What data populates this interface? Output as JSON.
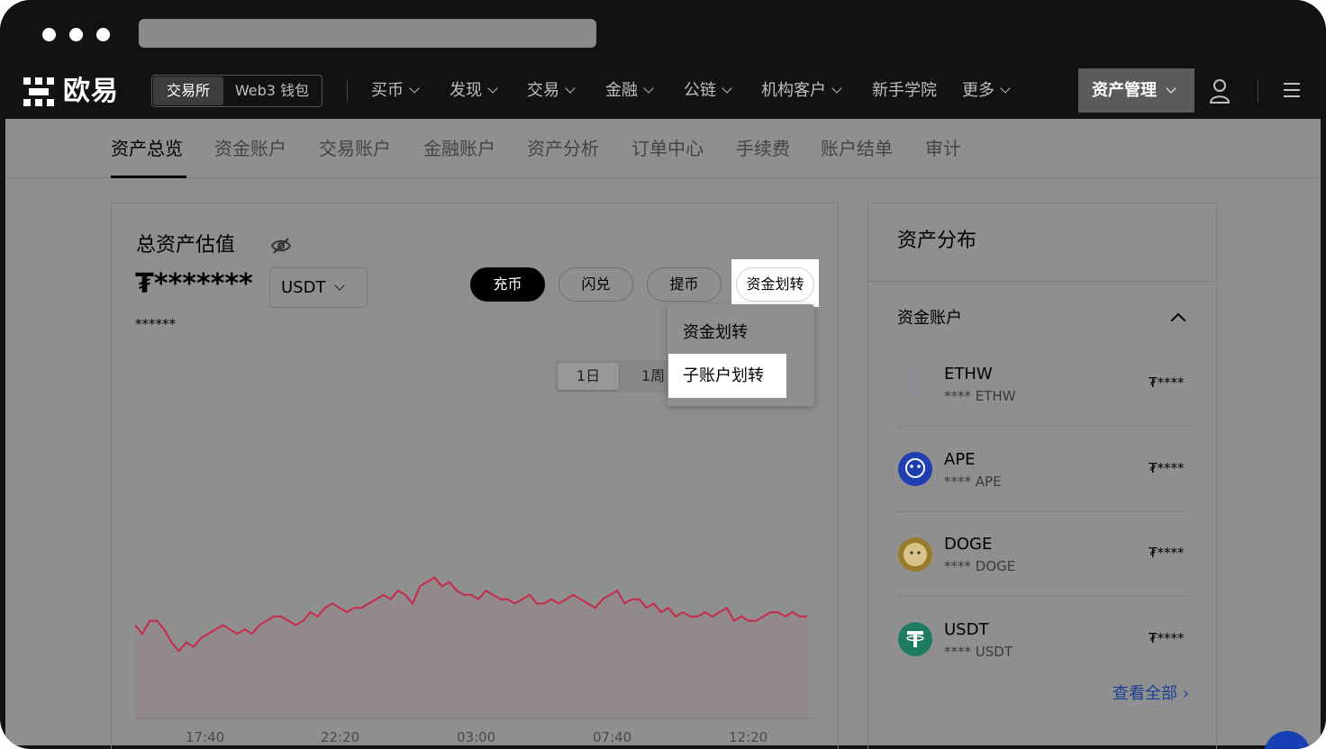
{
  "brand": {
    "name": "欧易"
  },
  "segment": {
    "exchange": "交易所",
    "wallet": "Web3 钱包"
  },
  "nav": {
    "items": [
      "买币",
      "发现",
      "交易",
      "金融",
      "公链",
      "机构客户",
      "新手学院",
      "更多"
    ],
    "asset_management": "资产管理"
  },
  "subnav": {
    "items": [
      "资产总览",
      "资金账户",
      "交易账户",
      "金融账户",
      "资产分析",
      "订单中心",
      "手续费",
      "账户结单",
      "审计"
    ],
    "active": "资产总览"
  },
  "overview": {
    "title": "总资产估值",
    "value_masked": "₮*******",
    "sub_value_masked": "******",
    "currency": "USDT",
    "actions": {
      "deposit": "充币",
      "convert": "闪兑",
      "withdraw": "提币",
      "transfer": "资金划转"
    },
    "transfer_menu": [
      "资金划转",
      "子账户划转"
    ],
    "ranges": [
      "1日",
      "1周"
    ]
  },
  "chart_data": {
    "type": "line",
    "x_ticks": [
      "17:40",
      "22:20",
      "03:00",
      "07:40",
      "12:20"
    ],
    "color": "#c62a4a",
    "values": [
      62,
      60,
      63,
      63,
      61,
      58,
      56,
      58,
      57,
      59,
      60,
      61,
      62,
      61,
      60,
      61,
      60,
      62,
      63,
      64,
      64,
      63,
      62,
      63,
      65,
      64,
      66,
      67,
      66,
      65,
      66,
      66,
      67,
      68,
      69,
      68,
      70,
      69,
      67,
      71,
      72,
      73,
      71,
      72,
      70,
      69,
      69,
      68,
      70,
      69,
      68,
      68,
      67,
      68,
      69,
      67,
      67,
      68,
      67,
      68,
      69,
      68,
      67,
      66,
      68,
      69,
      70,
      67,
      68,
      68,
      66,
      67,
      65,
      66,
      64,
      65,
      64,
      64,
      65,
      64,
      65,
      66,
      63,
      64,
      63,
      63,
      64,
      65,
      65,
      64,
      65,
      64,
      64
    ],
    "ylim": [
      40,
      90
    ]
  },
  "distribution": {
    "title": "资产分布",
    "section": "资金账户",
    "coins": [
      {
        "name": "ETHW",
        "sub": "**** ETHW",
        "value": "₮****",
        "icon": "ethw-icon",
        "color": "#8a8f9a"
      },
      {
        "name": "APE",
        "sub": "**** APE",
        "value": "₮****",
        "icon": "ape-icon",
        "color": "#1f3fb0"
      },
      {
        "name": "DOGE",
        "sub": "**** DOGE",
        "value": "₮****",
        "icon": "doge-icon",
        "color": "#b8922e"
      },
      {
        "name": "USDT",
        "sub": "**** USDT",
        "value": "₮****",
        "icon": "usdt-icon",
        "color": "#1f7a62"
      }
    ],
    "view_all": "查看全部 ›"
  }
}
